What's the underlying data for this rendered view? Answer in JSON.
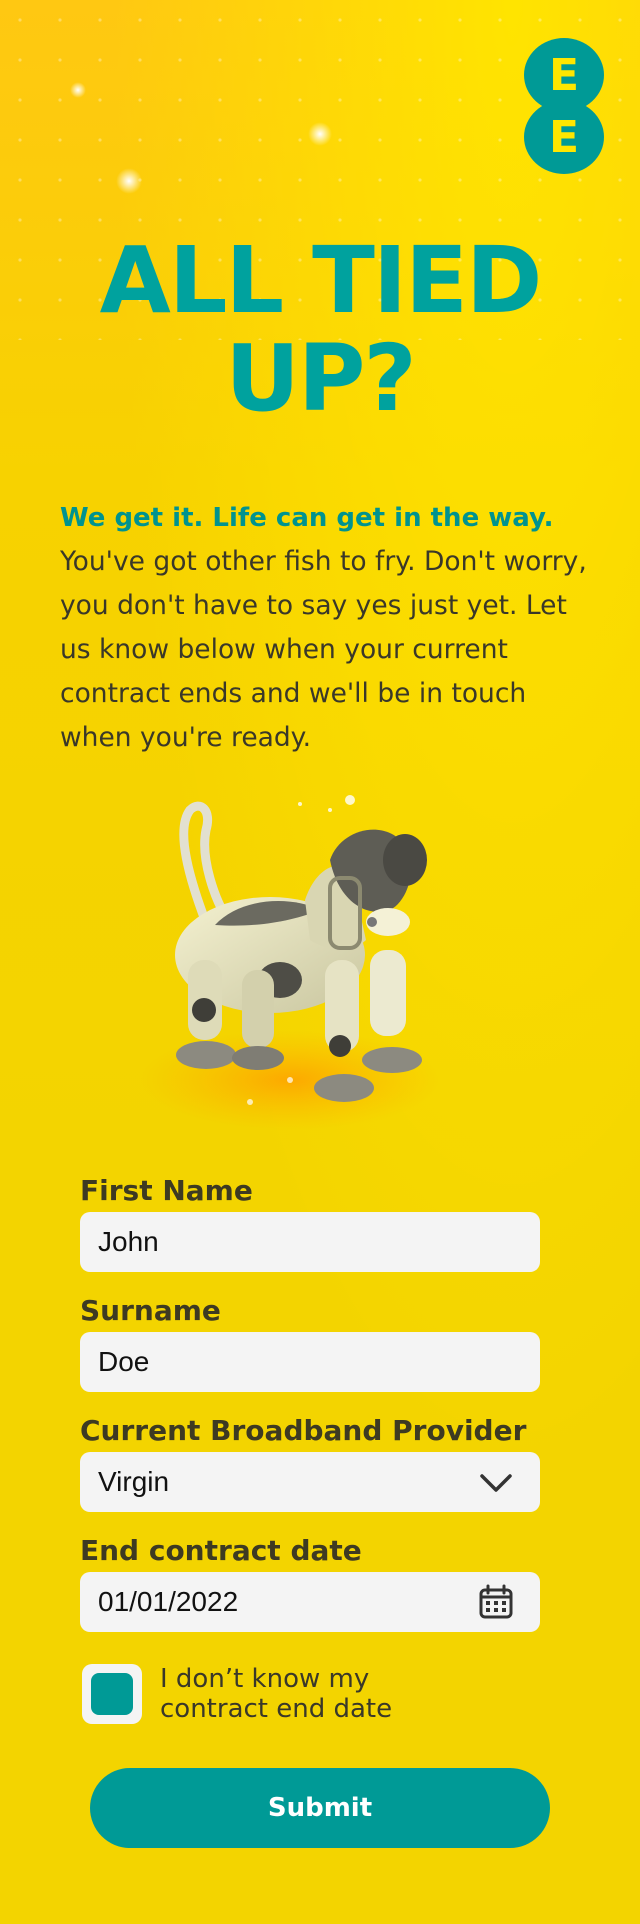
{
  "brand": {
    "logo_letter_top": "E",
    "logo_letter_bottom": "E",
    "accent_color": "#009a96",
    "background_color": "#f3d400"
  },
  "hero": {
    "headline_line1": "ALL TIED",
    "headline_line2": "UP?",
    "lead": "We get it. Life can get in the way.",
    "body": "You've got other fish to fry. Don't worry, you don't have to say yes just yet. Let us know below when your current contract ends and we'll be in touch when you're ready."
  },
  "form": {
    "first_name_label": "First Name",
    "first_name_value": "John",
    "surname_label": "Surname",
    "surname_value": "Doe",
    "provider_label": "Current Broadband Provider",
    "provider_value": "Virgin",
    "end_date_label": "End contract date",
    "end_date_value": "01/01/2022",
    "unknown_date_label_line1": "I don’t know my",
    "unknown_date_label_line2": "contract end date",
    "unknown_date_checked": true,
    "submit_label": "Submit"
  },
  "icons": {
    "dropdown": "chevron-down-icon",
    "date": "calendar-icon"
  }
}
